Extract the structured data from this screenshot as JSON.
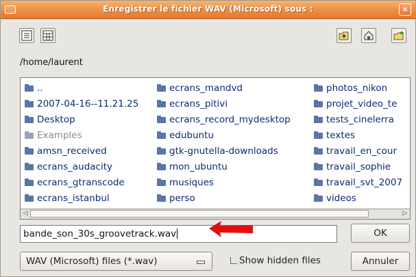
{
  "window": {
    "title": "Enregistrer le fichier WAV (Microsoft) sous :",
    "close_label": "×"
  },
  "toolbar": {
    "left_buttons": [
      {
        "icon": "list-view-icon"
      },
      {
        "icon": "detail-view-icon"
      }
    ],
    "right_buttons": [
      {
        "icon": "parent-folder-icon"
      },
      {
        "icon": "home-folder-icon"
      },
      {
        "icon": "new-folder-icon"
      }
    ]
  },
  "current_path": "/home/laurent",
  "files": {
    "col1": [
      {
        "name": ".."
      },
      {
        "name": "2007-04-16--11.21.25"
      },
      {
        "name": "Desktop"
      },
      {
        "name": "Examples",
        "dim": true
      },
      {
        "name": "amsn_received"
      },
      {
        "name": "ecrans_audacity"
      },
      {
        "name": "ecrans_gtranscode"
      },
      {
        "name": "ecrans_istanbul"
      }
    ],
    "col2": [
      {
        "name": "ecrans_mandvd"
      },
      {
        "name": "ecrans_pitivi"
      },
      {
        "name": "ecrans_record_mydesktop"
      },
      {
        "name": "edubuntu"
      },
      {
        "name": "gtk-gnutella-downloads"
      },
      {
        "name": "mon_ubuntu"
      },
      {
        "name": "musiques"
      },
      {
        "name": "perso"
      }
    ],
    "col3": [
      {
        "name": "photos_nikon"
      },
      {
        "name": "projet_video_te"
      },
      {
        "name": "tests_cinelerra"
      },
      {
        "name": "textes"
      },
      {
        "name": "travail_en_cour"
      },
      {
        "name": "travail_sophie"
      },
      {
        "name": "travail_svt_2007"
      },
      {
        "name": "videos"
      }
    ]
  },
  "filename": {
    "value": "bande_son_30s_groovetrack.wav"
  },
  "buttons": {
    "ok": "OK",
    "cancel": "Annuler"
  },
  "filter": {
    "selected": "WAV (Microsoft) files (*.wav)"
  },
  "show_hidden": {
    "label": "Show hidden files",
    "checked": false
  },
  "colors": {
    "title_bar": "#ee944a",
    "folder_text": "#0b2a70",
    "annotation": "#e01010"
  }
}
